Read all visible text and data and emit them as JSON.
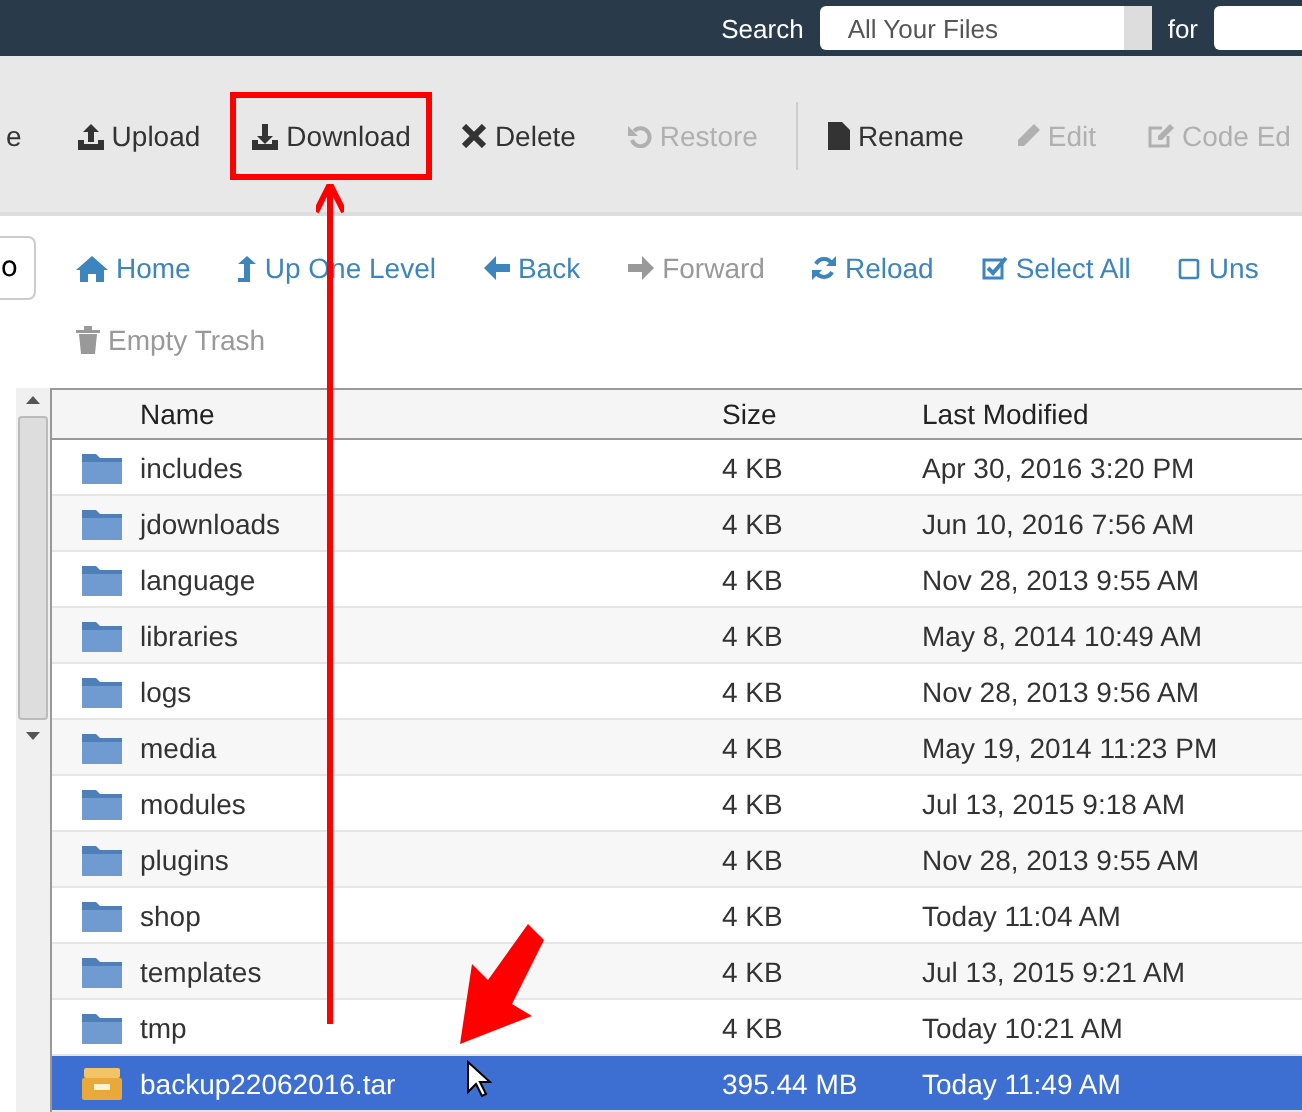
{
  "top_bar": {
    "search_label": "Search",
    "scope_select": {
      "value": "All Your Files"
    },
    "for_label": "for"
  },
  "toolbar": {
    "cut_left": "e",
    "buttons": [
      {
        "label": "Upload",
        "disabled": false,
        "highlighted": false
      },
      {
        "label": "Download",
        "disabled": false,
        "highlighted": true
      },
      {
        "label": "Delete",
        "disabled": false,
        "highlighted": false
      },
      {
        "label": "Restore",
        "disabled": true,
        "highlighted": false
      },
      {
        "label": "Rename",
        "disabled": false,
        "highlighted": false
      },
      {
        "label": "Edit",
        "disabled": true,
        "highlighted": false
      },
      {
        "label": "Code Ed",
        "disabled": true,
        "highlighted": false
      }
    ]
  },
  "nav": {
    "go_button": "o",
    "links": [
      {
        "label": "Home",
        "disabled": false
      },
      {
        "label": "Up One Level",
        "disabled": false
      },
      {
        "label": "Back",
        "disabled": false
      },
      {
        "label": "Forward",
        "disabled": true
      },
      {
        "label": "Reload",
        "disabled": false
      },
      {
        "label": "Select All",
        "disabled": false
      },
      {
        "label": "Uns",
        "disabled": false
      },
      {
        "label": "Empty Trash",
        "disabled": true
      }
    ]
  },
  "table": {
    "columns": [
      "Name",
      "Size",
      "Last Modified"
    ],
    "rows": [
      {
        "kind": "folder",
        "name": "includes",
        "size": "4 KB",
        "modified": "Apr 30, 2016 3:20 PM",
        "selected": false
      },
      {
        "kind": "folder",
        "name": "jdownloads",
        "size": "4 KB",
        "modified": "Jun 10, 2016 7:56 AM",
        "selected": false
      },
      {
        "kind": "folder",
        "name": "language",
        "size": "4 KB",
        "modified": "Nov 28, 2013 9:55 AM",
        "selected": false
      },
      {
        "kind": "folder",
        "name": "libraries",
        "size": "4 KB",
        "modified": "May 8, 2014 10:49 AM",
        "selected": false
      },
      {
        "kind": "folder",
        "name": "logs",
        "size": "4 KB",
        "modified": "Nov 28, 2013 9:56 AM",
        "selected": false
      },
      {
        "kind": "folder",
        "name": "media",
        "size": "4 KB",
        "modified": "May 19, 2014 11:23 PM",
        "selected": false
      },
      {
        "kind": "folder",
        "name": "modules",
        "size": "4 KB",
        "modified": "Jul 13, 2015 9:18 AM",
        "selected": false
      },
      {
        "kind": "folder",
        "name": "plugins",
        "size": "4 KB",
        "modified": "Nov 28, 2013 9:55 AM",
        "selected": false
      },
      {
        "kind": "folder",
        "name": "shop",
        "size": "4 KB",
        "modified": "Today 11:04 AM",
        "selected": false
      },
      {
        "kind": "folder",
        "name": "templates",
        "size": "4 KB",
        "modified": "Jul 13, 2015 9:21 AM",
        "selected": false
      },
      {
        "kind": "folder",
        "name": "tmp",
        "size": "4 KB",
        "modified": "Today 10:21 AM",
        "selected": false
      },
      {
        "kind": "archive",
        "name": "backup22062016.tar",
        "size": "395.44 MB",
        "modified": "Today 11:49 AM",
        "selected": true
      }
    ]
  }
}
